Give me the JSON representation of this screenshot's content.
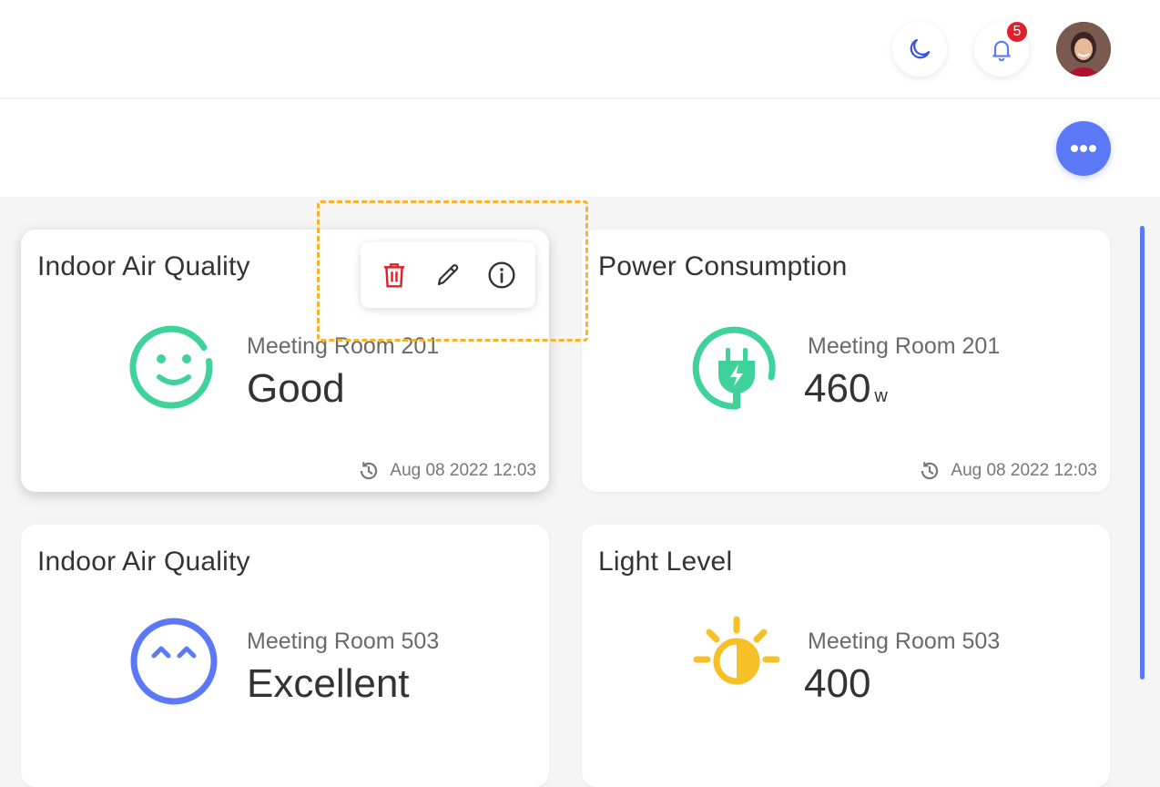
{
  "header": {
    "theme_toggle_icon": "moon-icon",
    "notifications": {
      "icon": "bell-icon",
      "count": "5"
    },
    "avatar": "avatar"
  },
  "toolbar_more_icon": "more-horizontal-icon",
  "colors": {
    "accent": "#5b78f6",
    "good_green": "#3fd39b",
    "light_yellow": "#f6c026",
    "delete_red": "#e0202a",
    "highlight_dashed": "#f6b42c"
  },
  "card_actions": {
    "delete_icon": "trash-icon",
    "edit_icon": "pencil-icon",
    "info_icon": "info-icon"
  },
  "cards": [
    {
      "title": "Indoor Air Quality",
      "icon": "smiley-icon",
      "room": "Meeting Room 201",
      "value": "Good",
      "unit": "",
      "timestamp": "Aug 08 2022 12:03"
    },
    {
      "title": "Power Consumption",
      "icon": "plug-icon",
      "room": "Meeting Room 201",
      "value": "460",
      "unit": "w",
      "timestamp": "Aug 08 2022 12:03"
    },
    {
      "title": "Indoor Air Quality",
      "icon": "happy-face-icon",
      "room": "Meeting Room 503",
      "value": "Excellent",
      "unit": "",
      "timestamp": ""
    },
    {
      "title": "Light Level",
      "icon": "sun-icon",
      "room": "Meeting Room 503",
      "value": "400",
      "unit": "",
      "timestamp": ""
    }
  ]
}
